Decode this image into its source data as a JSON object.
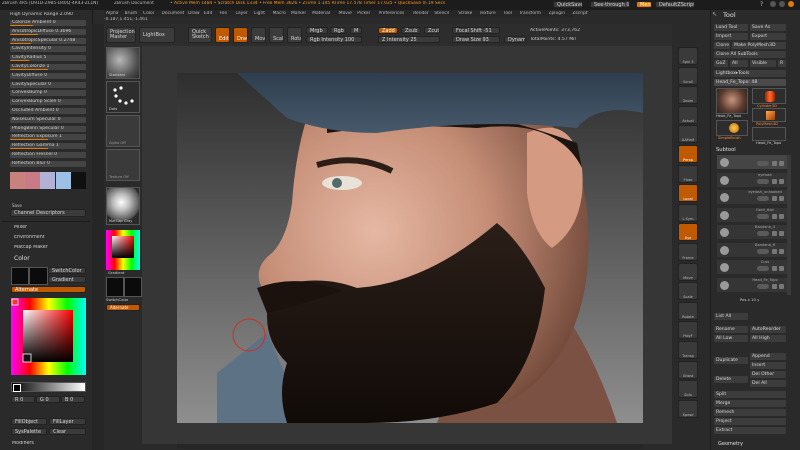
{
  "app": {
    "title": "ZBrush 4R5 [D91D-Z985-D40Q-4R43-ZL1N]",
    "document_label": "ZBrush Document",
    "status": "• Active Mem 1484 • Scratch Disk 1334 • Free Mem 3626 • ZTime 1.145 RTime 17.578 Timer 17.025 • QuickSave In 19 Secs",
    "quicksave_label": "QuickSave",
    "seethrough_label": "See-through 0",
    "menus_label": "Menus",
    "script_label": "DefaultZScript"
  },
  "menu_bar": [
    "Alpha",
    "Brush",
    "Color",
    "Document",
    "Draw",
    "Edit",
    "File",
    "Layer",
    "Light",
    "Macro",
    "Marker",
    "Material",
    "Movie",
    "Picker",
    "Preferences",
    "Render",
    "Stencil",
    "Stroke",
    "Texture",
    "Tool",
    "Transform",
    "Zplugin",
    "Zscript"
  ],
  "coords": "-0.187,1.451,-1.461",
  "top_toolbar": {
    "projection_master": "Projection Master",
    "lightbox": "LightBox",
    "quick_sketch": "Quick Sketch",
    "edit": "Edit",
    "draw": "Draw",
    "move": "Move",
    "scale": "Scale",
    "rotate": "Rotate",
    "mrgb": "Mrgb",
    "rgb": "Rgb",
    "m": "M",
    "rgb_intensity": "Rgb Intensity 100",
    "zadd": "Zadd",
    "zsub": "Zsub",
    "zcut": "Zcut",
    "z_intensity": "Z Intensity 25",
    "focal_shift": "Focal Shift -51",
    "draw_size": "Draw Size 93",
    "dynamic": "Dynamic",
    "active_points": "ActivePoints: 373,762",
    "total_points": "TotalPoints: 4.57 Mil"
  },
  "left_panel": {
    "top_label": "High Dynamic Range 2.090",
    "rows": [
      "Colorize Ambient 0",
      "AnisotropicDiffuse 0.3696",
      "AnisotropicSpecular 0.2748",
      "CavityIntensity 0",
      "CavityRadius 5",
      "CavityColorize 1",
      "CavityDiffuse 0",
      "CavitySpecular 0",
      "ConvexBump 0",
      "ConvexBump Scale 0",
      "Occluded Ambient 0",
      "NoiseLum Specular 0",
      "PhongBlinn Specular 0",
      "Reflection Exposure 1",
      "Reflection Gamma 1",
      "Reflection Fresnel 0",
      "Reflection Blur 0"
    ],
    "fills": [
      0.3,
      0.37,
      0.27,
      0,
      0.25,
      0.5,
      0,
      0,
      0,
      0,
      0,
      0,
      0,
      0.5,
      0.5,
      0,
      0
    ],
    "swatches": [
      "#c9817e",
      "#c97a86",
      "#b4b1d6",
      "#9cc0e6",
      "#101010"
    ],
    "save_label": "Save",
    "channel_descriptors": "Channel Descriptors",
    "sections": [
      "Mixer",
      "Environment",
      "Matcap Maker"
    ],
    "color_title": "Color",
    "switchcolor": "SwitchColor",
    "gradient": "Gradient",
    "alternate": "Alternate",
    "slider_values": [
      "R 0",
      "G 0",
      "B 0"
    ],
    "fill_object": "FillObject",
    "fill_layer": "FillLayer",
    "syspalette": "SysPalette",
    "clear": "Clear",
    "modifiers": "Modifiers"
  },
  "shelf": {
    "labels": [
      "Standard",
      "Dots",
      "Alpha Off",
      "Texture Off",
      "MatCap Gray",
      "Gradient",
      "SwitchColor",
      "Alternate"
    ]
  },
  "right_icons": [
    "Spix 3",
    "Scroll",
    "Zoom",
    "Actual",
    "AAHalf",
    "Persp",
    "Floor",
    "Local",
    "L.Sym",
    "Xyz",
    "Frame",
    "Move",
    "Scale",
    "Rotate",
    "PolyF",
    "Transp",
    "Ghost",
    "Solo",
    "Xpose"
  ],
  "tool_panel": {
    "title": "Tool",
    "load_tool": "Load Tool",
    "save_as": "Save As",
    "import": "Import",
    "export": "Export",
    "clone": "Clone",
    "make_polymesh": "Make PolyMesh3D",
    "clone_all": "Clone All SubTools",
    "goz": "GoZ",
    "all": "All",
    "visible": "Visible",
    "r": "R",
    "lightbox_tools": "Lightbox▸Tools",
    "current_tool": "Head_Fe_Topo: 48",
    "thumbs": [
      "Head_Fe_Topo",
      "Cylinder3D",
      "SimpleBrush",
      "PolyMesh3D",
      "Head_Fe_Topo"
    ],
    "subtool_title": "Subtool",
    "subtools": [
      "",
      "eyelash",
      "eyelash_unhooked",
      "Gerit_Hair",
      "Bandana_4",
      "Bandana_6",
      "Cuss",
      "Head_Fe_Topo"
    ],
    "list_all": "List All",
    "rename": "Rename",
    "autoreorder": "AutoReorder",
    "all_low": "All Low",
    "all_high": "All High",
    "duplicate": "Duplicate",
    "append": "Append",
    "insert": "Insert",
    "delete": "Delete",
    "del_other": "Del Other",
    "del_all": "Del All",
    "split": "Split",
    "merge": "Merge",
    "remesh": "Remesh",
    "project": "Project",
    "extract": "Extract",
    "geometry": "Geometry",
    "pos_label": "Pos x 10 y"
  },
  "colors": {
    "accent": "#e07a00",
    "panel": "#2a2a2a",
    "button": "#3b3b3b"
  }
}
